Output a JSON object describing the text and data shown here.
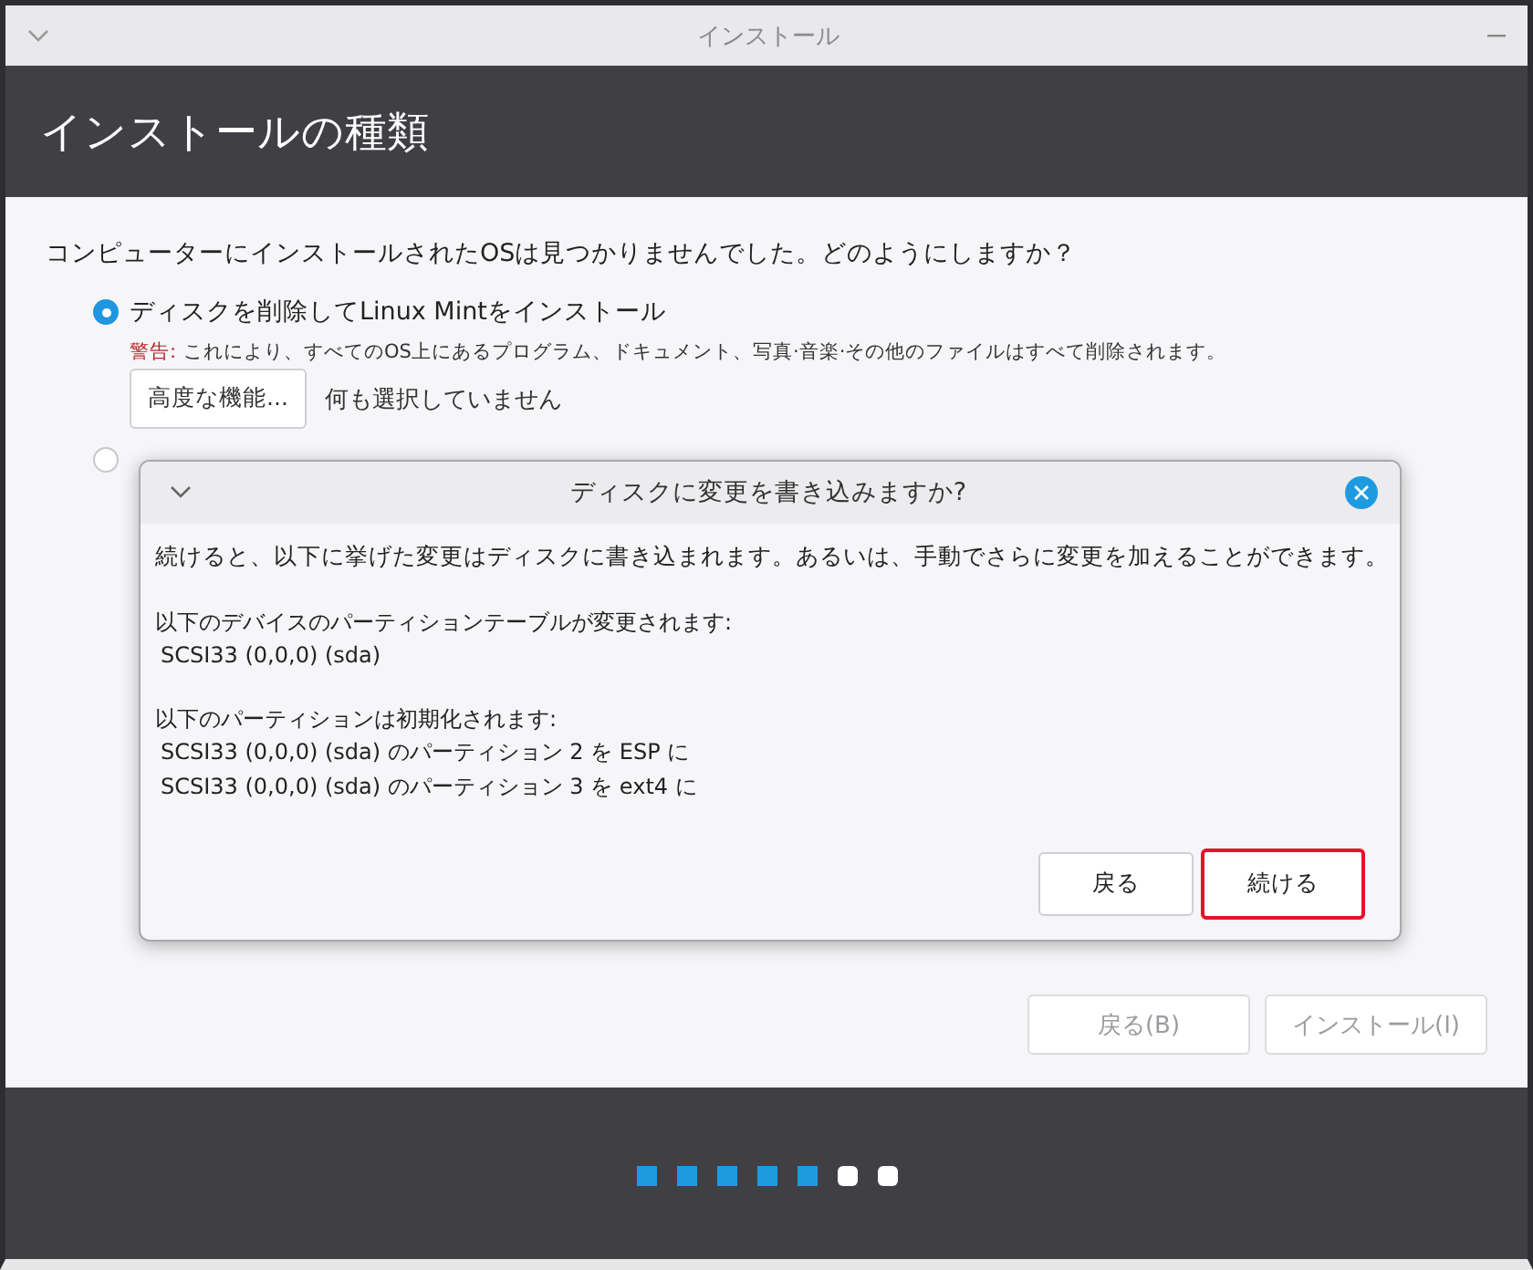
{
  "window": {
    "title": "インストール"
  },
  "header": {
    "title": "インストールの種類"
  },
  "question": "コンピューターにインストールされたOSは見つかりませんでした。どのようにしますか？",
  "options": [
    {
      "label": "ディスクを削除してLinux Mintをインストール",
      "selected": true,
      "warning_label": "警告:",
      "warning_text": "これにより、すべてのOS上にあるプログラム、ドキュメント、写真·音楽·その他のファイルはすべて削除されます。",
      "advanced_button": "高度な機能...",
      "advanced_status": "何も選択していません"
    },
    {
      "selected": false
    }
  ],
  "nav_buttons": [
    {
      "label": "戻る(B)",
      "disabled": true
    },
    {
      "label": "インストール(I)",
      "disabled": true
    }
  ],
  "progress": [
    {
      "done": true
    },
    {
      "done": true
    },
    {
      "done": true
    },
    {
      "done": true
    },
    {
      "done": true
    },
    {
      "done": false
    },
    {
      "done": false
    }
  ],
  "dialog": {
    "title": "ディスクに変更を書き込みますか?",
    "message": "続けると、以下に挙げた変更はディスクに書き込まれます。あるいは、手動でさらに変更を加えることができます。",
    "sections": [
      {
        "heading": "以下のデバイスのパーティションテーブルが変更されます:",
        "items": [
          "SCSI33 (0,0,0) (sda)"
        ]
      },
      {
        "heading": "以下のパーティションは初期化されます:",
        "items": [
          "SCSI33 (0,0,0) (sda) のパーティション 2 を ESP に",
          "SCSI33 (0,0,0) (sda) のパーティション 3 を ext4 に"
        ]
      }
    ],
    "buttons": [
      {
        "label": "戻る",
        "highlighted": false
      },
      {
        "label": "続ける",
        "highlighted": true
      }
    ]
  }
}
